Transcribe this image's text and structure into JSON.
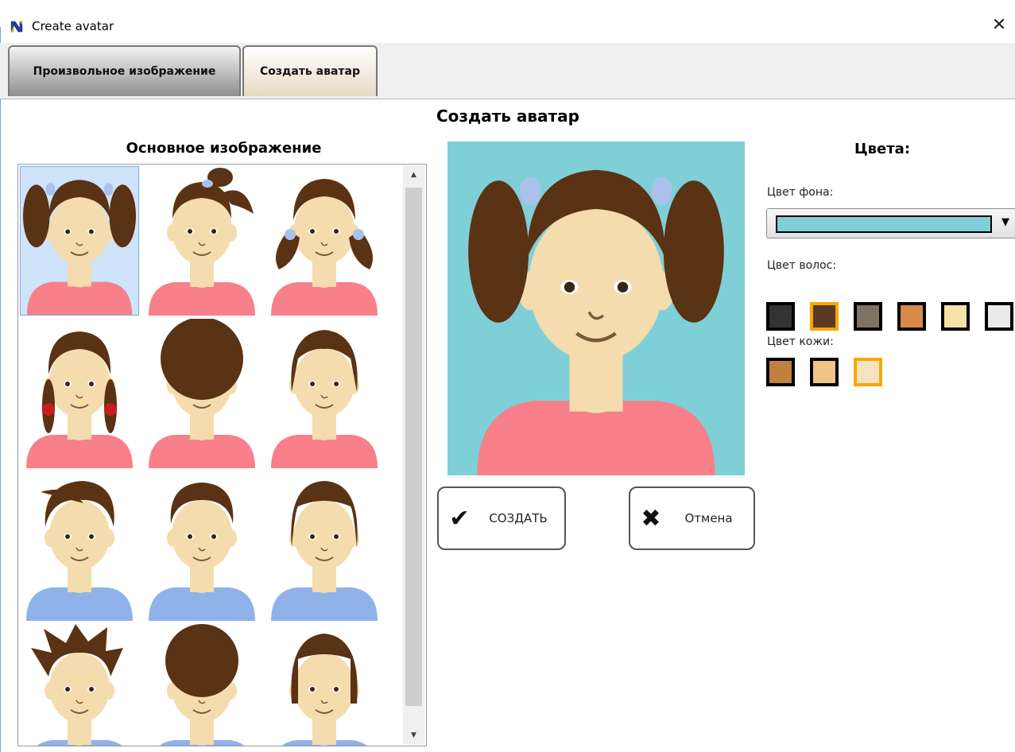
{
  "window": {
    "title": "Create avatar",
    "close_glyph": "✕"
  },
  "tabs": [
    {
      "label": "Произвольное изображение",
      "active": false
    },
    {
      "label": "Создать аватар",
      "active": true
    }
  ],
  "page": {
    "title": "Создать аватар"
  },
  "gallery": {
    "title": "Основное изображение",
    "selected_index": 0,
    "items": [
      {
        "hair": "pigtails",
        "shirt": "#f7808a"
      },
      {
        "hair": "ponytail",
        "shirt": "#f7808a"
      },
      {
        "hair": "low-pigtails",
        "shirt": "#f7808a"
      },
      {
        "hair": "braids",
        "shirt": "#f7808a"
      },
      {
        "hair": "curly-girl",
        "shirt": "#f7808a"
      },
      {
        "hair": "bob",
        "shirt": "#f7808a"
      },
      {
        "hair": "boy-swept",
        "shirt": "#8fb2ea"
      },
      {
        "hair": "boy-short",
        "shirt": "#8fb2ea"
      },
      {
        "hair": "boy-long",
        "shirt": "#8fb2ea"
      },
      {
        "hair": "boy-spiky",
        "shirt": "#8fb2ea"
      },
      {
        "hair": "boy-curly",
        "shirt": "#8fb2ea"
      },
      {
        "hair": "boy-bowl",
        "shirt": "#8fb2ea"
      }
    ]
  },
  "preview": {
    "background_color": "#7fcfd7",
    "hair_color": "#5a3214",
    "skin_color": "#f4dcae",
    "shirt_color": "#f7808a"
  },
  "buttons": {
    "create": {
      "label": "СОЗДАТЬ",
      "icon": "checkmark-icon"
    },
    "cancel": {
      "label": "Отмена",
      "icon": "x-icon"
    }
  },
  "colors": {
    "title": "Цвета:",
    "background": {
      "label": "Цвет фона:",
      "value": "#7fcfd7"
    },
    "hair": {
      "label": "Цвет волос:",
      "swatches": [
        "#333333",
        "#5a3a22",
        "#7f7262",
        "#d98a4a",
        "#f6e2a8",
        "#e9e9e9"
      ],
      "selected": 1
    },
    "skin": {
      "label": "Цвет кожи:",
      "swatches": [
        "#c0803e",
        "#efc487",
        "#f7e1c3"
      ],
      "selected": 2
    }
  }
}
